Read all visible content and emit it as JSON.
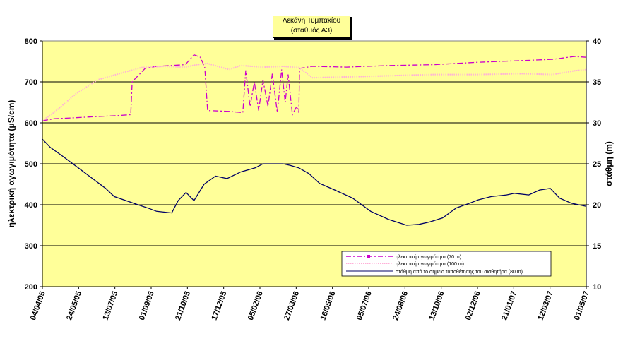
{
  "chart_data": {
    "type": "line",
    "title": "Λεκάνη Τυμπακίου",
    "subtitle": "(σταθμός Α3)",
    "ylabel": "ηλεκτρική αγωγιμότητα (μS/cm)",
    "y2label": "στάθμη (m)",
    "xlabel": "",
    "ylim": [
      200,
      800
    ],
    "y2lim": [
      10,
      40
    ],
    "yticks": [
      "200",
      "300",
      "400",
      "500",
      "600",
      "700",
      "800"
    ],
    "y2ticks": [
      "10",
      "15",
      "20",
      "25",
      "30",
      "35",
      "40"
    ],
    "xlim": [
      "2005-04-04",
      "2007-05-01"
    ],
    "xticks": [
      "04/04/05",
      "24/05/05",
      "13/07/05",
      "01/09/05",
      "21/10/05",
      "17/12/05",
      "05/02/06",
      "27/03/06",
      "16/05/06",
      "05/07/06",
      "24/08/06",
      "13/10/06",
      "02/12/06",
      "21/01/07",
      "12/03/07",
      "01/05/07"
    ],
    "grid": "horizontal",
    "plot_background": "#ffff99",
    "legend_position": "bottom-right",
    "series": [
      {
        "name": "ηλεκτρική αγωγιμότητα (70 m)",
        "axis": "left",
        "color": "#cc00cc",
        "style": "dash-dot",
        "x": [
          "2005-04-04",
          "2005-04-20",
          "2005-05-15",
          "2005-06-15",
          "2005-07-20",
          "2005-08-05",
          "2005-08-07",
          "2005-08-25",
          "2005-09-10",
          "2005-10-01",
          "2005-10-20",
          "2005-11-01",
          "2005-11-10",
          "2005-11-16",
          "2005-11-20",
          "2005-12-20",
          "2006-01-08",
          "2006-01-12",
          "2006-01-18",
          "2006-01-24",
          "2006-01-30",
          "2006-02-05",
          "2006-02-12",
          "2006-02-18",
          "2006-02-25",
          "2006-03-03",
          "2006-03-08",
          "2006-03-12",
          "2006-03-18",
          "2006-03-24",
          "2006-03-27",
          "2006-03-28",
          "2006-04-15",
          "2006-06-01",
          "2006-08-01",
          "2006-10-01",
          "2006-12-01",
          "2007-02-01",
          "2007-03-15",
          "2007-04-15",
          "2007-05-01"
        ],
        "y": [
          605,
          610,
          612,
          615,
          618,
          620,
          700,
          733,
          738,
          740,
          742,
          766,
          760,
          735,
          630,
          628,
          625,
          728,
          640,
          700,
          630,
          705,
          640,
          720,
          625,
          730,
          650,
          718,
          620,
          640,
          625,
          733,
          738,
          736,
          740,
          742,
          748,
          752,
          755,
          762,
          760
        ]
      },
      {
        "name": "ηλεκτρική αγωγιμότητα (100 m)",
        "axis": "left",
        "color": "#ffb0d8",
        "style": "dotted",
        "x": [
          "2005-04-04",
          "2005-04-20",
          "2005-05-20",
          "2005-06-20",
          "2005-07-20",
          "2005-08-20",
          "2005-09-20",
          "2005-10-20",
          "2005-11-05",
          "2005-11-20",
          "2005-12-20",
          "2006-01-05",
          "2006-02-05",
          "2006-03-05",
          "2006-03-27",
          "2006-04-15",
          "2006-06-01",
          "2006-08-01",
          "2006-10-01",
          "2006-12-01",
          "2007-02-01",
          "2007-03-15",
          "2007-04-15",
          "2007-05-01"
        ],
        "y": [
          605,
          625,
          670,
          705,
          720,
          735,
          738,
          736,
          742,
          745,
          730,
          740,
          736,
          738,
          735,
          710,
          712,
          715,
          718,
          718,
          720,
          718,
          727,
          730
        ]
      },
      {
        "name": "στάθμη από το σημείο τοποθέτησης του αισθητήρα (80 m)",
        "axis": "right",
        "color": "#000066",
        "style": "solid",
        "x": [
          "2005-04-04",
          "2005-04-15",
          "2005-05-01",
          "2005-05-24",
          "2005-07-01",
          "2005-07-13",
          "2005-08-15",
          "2005-09-01",
          "2005-09-10",
          "2005-10-01",
          "2005-10-10",
          "2005-10-21",
          "2005-11-01",
          "2005-11-15",
          "2005-12-01",
          "2005-12-17",
          "2006-01-05",
          "2006-01-25",
          "2006-02-05",
          "2006-02-20",
          "2006-03-05",
          "2006-03-15",
          "2006-03-27",
          "2006-04-10",
          "2006-04-25",
          "2006-05-16",
          "2006-06-10",
          "2006-07-05",
          "2006-07-30",
          "2006-08-24",
          "2006-09-10",
          "2006-09-25",
          "2006-10-13",
          "2006-11-01",
          "2006-11-20",
          "2006-12-02",
          "2006-12-20",
          "2007-01-10",
          "2007-01-21",
          "2007-02-10",
          "2007-02-25",
          "2007-03-12",
          "2007-03-25",
          "2007-04-10",
          "2007-05-01"
        ],
        "y": [
          28,
          27,
          26,
          24.5,
          22,
          21,
          20,
          19.5,
          19.2,
          19,
          20.5,
          21.5,
          20.5,
          22.5,
          23.5,
          23.2,
          24,
          24.5,
          25,
          25,
          25,
          24.8,
          24.5,
          23.8,
          22.6,
          21.8,
          20.8,
          19.2,
          18.2,
          17.5,
          17.6,
          17.9,
          18.4,
          19.6,
          20.2,
          20.6,
          21,
          21.2,
          21.4,
          21.2,
          21.8,
          22,
          20.8,
          20.2,
          19.8
        ]
      }
    ]
  }
}
